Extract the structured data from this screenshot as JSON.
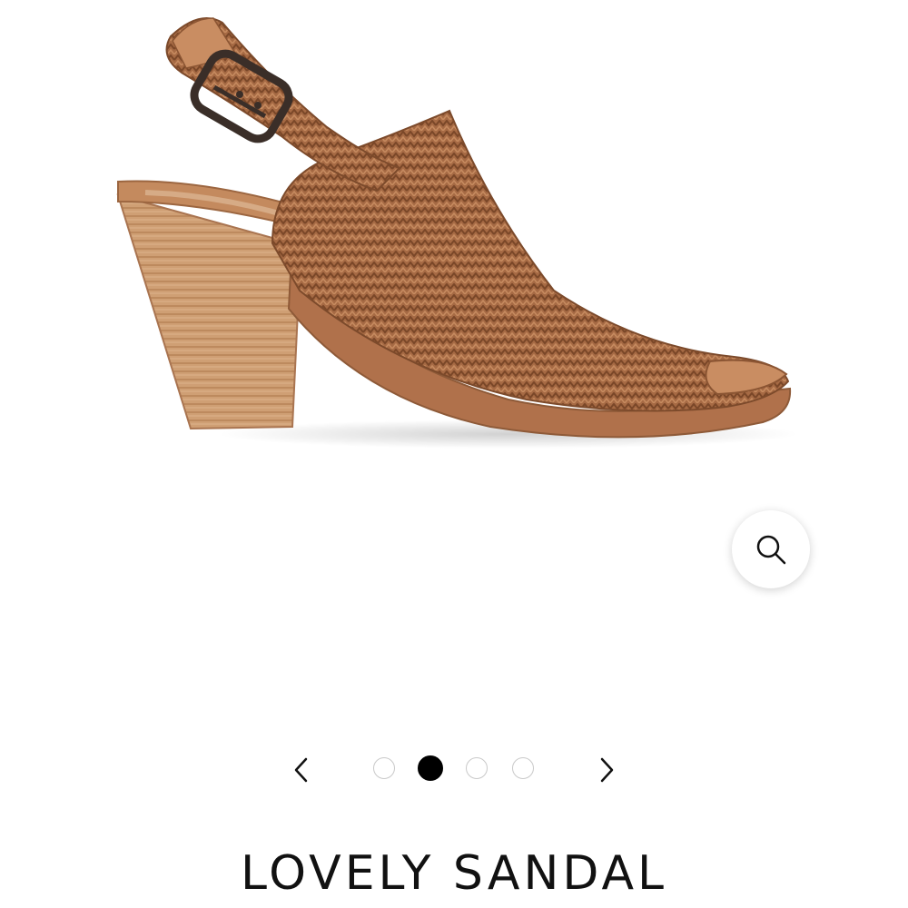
{
  "product": {
    "title": "LOVELY SANDAL",
    "image_icon": "woven-sandal-image"
  },
  "carousel": {
    "prev_icon": "chevron-left-icon",
    "next_icon": "chevron-right-icon",
    "total_slides": 4,
    "active_slide": 2
  },
  "zoom": {
    "icon": "magnifier-icon"
  },
  "colors": {
    "leather": "#a96b45",
    "leather_dark": "#7d4a2c",
    "heel": "#c9976d",
    "sole": "#b47550",
    "active_dot": "#000000",
    "inactive_dot_border": "#c9c9c9"
  }
}
